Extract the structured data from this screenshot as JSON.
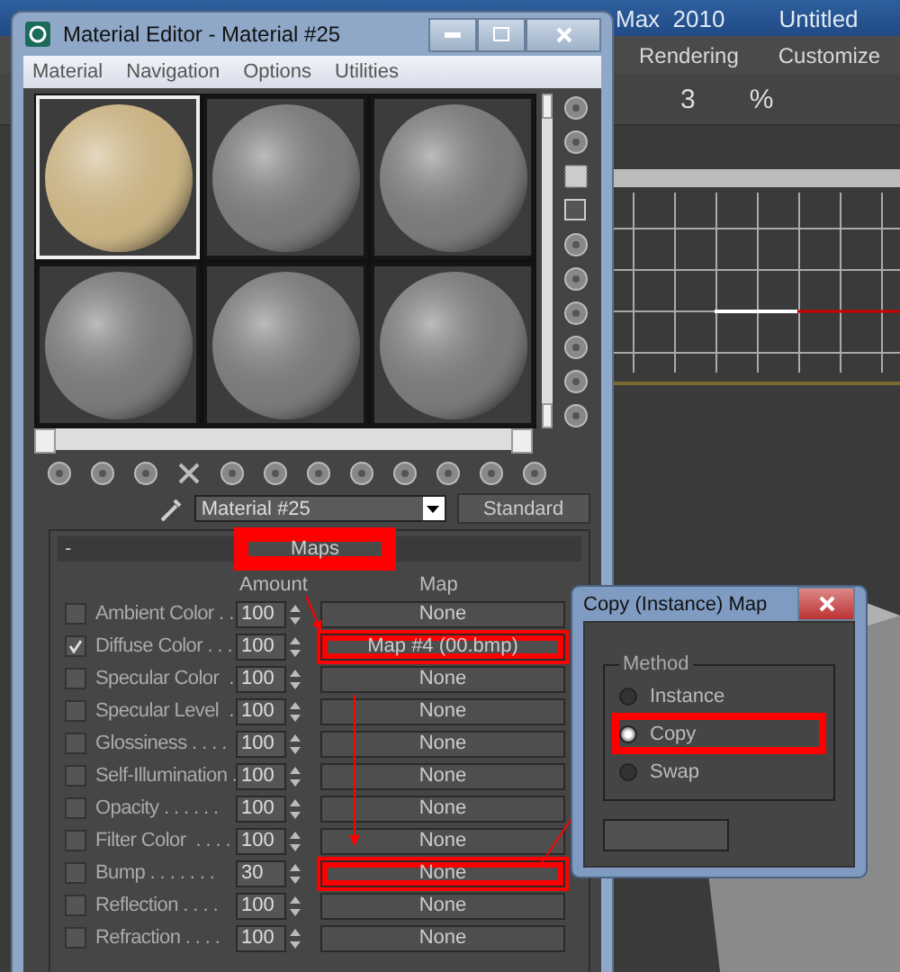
{
  "app": {
    "title_parts": [
      "Max  2010",
      "Untitled"
    ],
    "menu": [
      "Rendering",
      "Customize"
    ],
    "toolbar_glyphs": [
      "3",
      "%"
    ]
  },
  "material_editor": {
    "title": "Material Editor - Material #25",
    "menu": [
      "Material",
      "Navigation",
      "Options",
      "Utilities"
    ],
    "slots": [
      {
        "selected": true,
        "color": "#c9b384"
      },
      {
        "selected": false,
        "color": "#7a7a7a"
      },
      {
        "selected": false,
        "color": "#7a7a7a"
      },
      {
        "selected": false,
        "color": "#7a7a7a"
      },
      {
        "selected": false,
        "color": "#7a7a7a"
      },
      {
        "selected": false,
        "color": "#7a7a7a"
      }
    ],
    "material_name": "Material #25",
    "material_type": "Standard",
    "rollout": {
      "sign": "-",
      "title": "Maps",
      "highlighted": true
    },
    "columns": [
      "Amount",
      "Map"
    ],
    "maps": [
      {
        "name": "Ambient Color . .",
        "checked": false,
        "amount": "100",
        "map": "None",
        "highlighted": false
      },
      {
        "name": "Diffuse Color . . .",
        "checked": true,
        "amount": "100",
        "map": "Map #4 (00.bmp)",
        "highlighted": true
      },
      {
        "name": "Specular Color  .",
        "checked": false,
        "amount": "100",
        "map": "None",
        "highlighted": false
      },
      {
        "name": "Specular Level  .",
        "checked": false,
        "amount": "100",
        "map": "None",
        "highlighted": false
      },
      {
        "name": "Glossiness . . . .",
        "checked": false,
        "amount": "100",
        "map": "None",
        "highlighted": false
      },
      {
        "name": "Self-Illumination .",
        "checked": false,
        "amount": "100",
        "map": "None",
        "highlighted": false
      },
      {
        "name": "Opacity . . . . . .",
        "checked": false,
        "amount": "100",
        "map": "None",
        "highlighted": false
      },
      {
        "name": "Filter Color  . . . .",
        "checked": false,
        "amount": "100",
        "map": "None",
        "highlighted": false
      },
      {
        "name": "Bump . . . . . . .",
        "checked": false,
        "amount": "30",
        "map": "None",
        "highlighted": true
      },
      {
        "name": "Reflection . . . .",
        "checked": false,
        "amount": "100",
        "map": "None",
        "highlighted": false
      },
      {
        "name": "Refraction . . . .",
        "checked": false,
        "amount": "100",
        "map": "None",
        "highlighted": false
      }
    ]
  },
  "dialog": {
    "title": "Copy (Instance) Map",
    "group": "Method",
    "options": [
      {
        "label": "Instance",
        "selected": false,
        "highlighted": false
      },
      {
        "label": "Copy",
        "selected": true,
        "highlighted": true
      },
      {
        "label": "Swap",
        "selected": false,
        "highlighted": false
      }
    ]
  }
}
